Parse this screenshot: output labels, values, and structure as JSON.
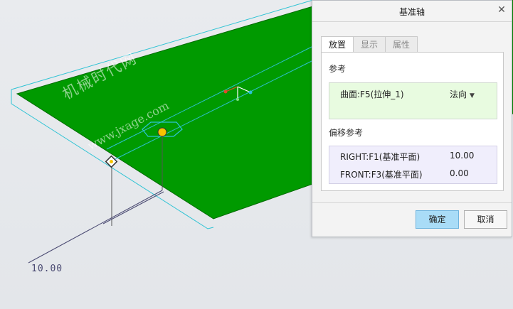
{
  "watermark": {
    "text_zh": "机械时代网",
    "text_en": "www.jxage.com"
  },
  "viewport": {
    "dimension_text": "10.00"
  },
  "dialog": {
    "title": "基准轴",
    "close_icon": "close-icon",
    "tabs": [
      {
        "label": "放置",
        "active": true
      },
      {
        "label": "显示",
        "active": false
      },
      {
        "label": "属性",
        "active": false
      }
    ],
    "references": {
      "label": "参考",
      "items": [
        {
          "name": "曲面:F5(拉伸_1)",
          "constraint": "法向"
        }
      ]
    },
    "offset_references": {
      "label": "偏移参考",
      "rows": [
        {
          "name": "RIGHT:F1(基准平面)",
          "value": "10.00"
        },
        {
          "name": "FRONT:F3(基准平面)",
          "value": "0.00"
        }
      ]
    },
    "buttons": {
      "ok": "确定",
      "cancel": "取消"
    }
  },
  "colors": {
    "surface": "#009a00",
    "datum_edge": "#2ec3d4",
    "dimension": "#4a4a72",
    "ok_button": "#a9dcf7",
    "reference_box": "#e8fbe0",
    "offset_box": "#f0eefc"
  }
}
